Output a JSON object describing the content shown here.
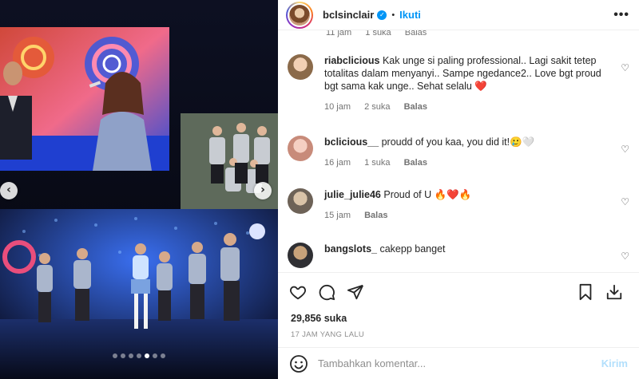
{
  "header": {
    "username": "bclsinclair",
    "separator": "•",
    "follow_label": "Ikuti",
    "more_label": "•••"
  },
  "top_meta": {
    "time": "11 jam",
    "likes": "1 suka",
    "reply": "Balas"
  },
  "comments": [
    {
      "username": "riabclicious",
      "text": "Kak unge si paling professional.. Lagi sakit tetep totalitas dalam menyanyi.. Sampe ngedance2.. Love bgt proud bgt sama kak unge.. Sehat selalu ❤️",
      "time": "10 jam",
      "likes": "2 suka",
      "reply": "Balas"
    },
    {
      "username": "bclicious__",
      "text": "proudd of you kaa, you did it!🥲🤍",
      "time": "16 jam",
      "likes": "1 suka",
      "reply": "Balas"
    },
    {
      "username": "julie_julie46",
      "text": "Proud of U 🔥❤️🔥",
      "time": "15 jam",
      "likes": "",
      "reply": "Balas"
    },
    {
      "username": "bangslots_",
      "text": "cakepp banget",
      "time": "",
      "likes": "",
      "reply": ""
    }
  ],
  "stats": {
    "likes": "29,856 suka",
    "posted": "17 JAM YANG LALU"
  },
  "add_comment": {
    "placeholder": "Tambahkan komentar...",
    "send_label": "Kirim"
  },
  "carousel": {
    "prev_label": "‹",
    "next_label": "›",
    "slides": 7,
    "active_index": 4
  },
  "colors": {
    "accent": "#0095f6",
    "send_disabled": "#b2dffc",
    "heart_red": "#ed4956"
  }
}
